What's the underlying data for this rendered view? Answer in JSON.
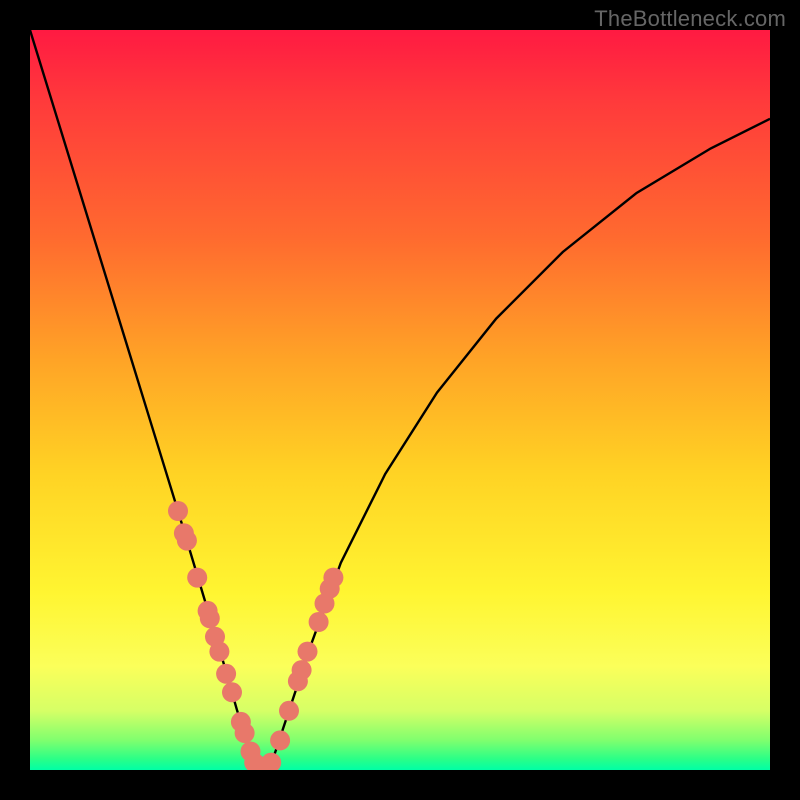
{
  "watermark": "TheBottleneck.com",
  "colors": {
    "curve": "#000000",
    "dot_fill": "#e8786a",
    "dot_stroke": "#c25a50"
  },
  "chart_data": {
    "type": "line",
    "title": "",
    "xlabel": "",
    "ylabel": "",
    "xlim": [
      0,
      100
    ],
    "ylim": [
      0,
      100
    ],
    "grid": false,
    "legend": false,
    "note": "V-shaped performance-balance curve. Minimum (green/optimal) around x≈31. y rises toward 100 (red/bottleneck) at both extremes.",
    "series": [
      {
        "name": "bottleneck_curve",
        "x": [
          0,
          4,
          8,
          12,
          16,
          20,
          23,
          26,
          28,
          30,
          31,
          33,
          35,
          38,
          42,
          48,
          55,
          63,
          72,
          82,
          92,
          100
        ],
        "y": [
          100,
          87,
          74,
          61,
          48,
          35,
          25,
          15,
          8,
          2,
          0,
          2,
          8,
          17,
          28,
          40,
          51,
          61,
          70,
          78,
          84,
          88
        ]
      }
    ],
    "marker_clusters": {
      "note": "Salmon circular data-point markers along both arms near the valley.",
      "left_arm": [
        {
          "x": 20.0,
          "y": 35.0
        },
        {
          "x": 20.8,
          "y": 32.0
        },
        {
          "x": 21.2,
          "y": 31.0
        },
        {
          "x": 22.6,
          "y": 26.0
        },
        {
          "x": 24.0,
          "y": 21.5
        },
        {
          "x": 24.3,
          "y": 20.5
        },
        {
          "x": 25.0,
          "y": 18.0
        },
        {
          "x": 25.6,
          "y": 16.0
        },
        {
          "x": 26.5,
          "y": 13.0
        },
        {
          "x": 27.3,
          "y": 10.5
        },
        {
          "x": 28.5,
          "y": 6.5
        },
        {
          "x": 29.0,
          "y": 5.0
        },
        {
          "x": 29.8,
          "y": 2.5
        }
      ],
      "valley": [
        {
          "x": 30.3,
          "y": 1.0
        },
        {
          "x": 31.0,
          "y": 0.5
        },
        {
          "x": 31.8,
          "y": 0.5
        },
        {
          "x": 32.6,
          "y": 1.0
        }
      ],
      "right_arm": [
        {
          "x": 33.8,
          "y": 4.0
        },
        {
          "x": 35.0,
          "y": 8.0
        },
        {
          "x": 36.2,
          "y": 12.0
        },
        {
          "x": 36.7,
          "y": 13.5
        },
        {
          "x": 37.5,
          "y": 16.0
        },
        {
          "x": 39.0,
          "y": 20.0
        },
        {
          "x": 39.8,
          "y": 22.5
        },
        {
          "x": 40.5,
          "y": 24.5
        },
        {
          "x": 41.0,
          "y": 26.0
        }
      ]
    }
  }
}
